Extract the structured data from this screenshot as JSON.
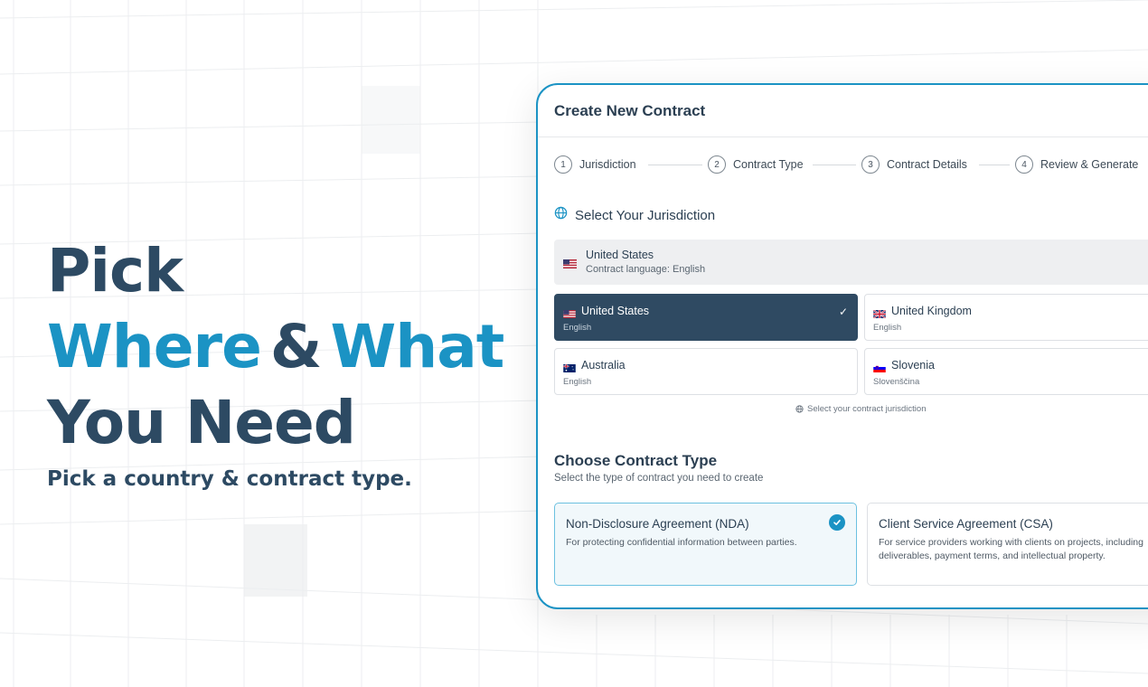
{
  "hero": {
    "line1": "Pick",
    "line2_word1": "Where",
    "line2_amp": "&",
    "line2_word2": "What",
    "line3": "You Need",
    "tagline": "Pick a country & contract type."
  },
  "dialog": {
    "title": "Create New Contract",
    "steps": [
      {
        "num": "1",
        "label": "Jurisdiction"
      },
      {
        "num": "2",
        "label": "Contract Type"
      },
      {
        "num": "3",
        "label": "Contract Details"
      },
      {
        "num": "4",
        "label": "Review & Generate"
      }
    ],
    "jurisdiction": {
      "heading": "Select Your Jurisdiction",
      "heading_icon": "globe-icon",
      "selected": {
        "name": "United States",
        "language": "Contract language: English"
      },
      "options": [
        {
          "name": "United States",
          "language": "English",
          "flag": "us-flag-icon",
          "active": true
        },
        {
          "name": "United Kingdom",
          "language": "English",
          "flag": "uk-flag-icon",
          "active": false
        },
        {
          "name": "Australia",
          "language": "English",
          "flag": "au-flag-icon",
          "active": false
        },
        {
          "name": "Slovenia",
          "language": "Slovenščina",
          "flag": "si-flag-icon",
          "active": false
        }
      ],
      "hint": "Select your contract jurisdiction"
    },
    "contract_type": {
      "heading": "Choose Contract Type",
      "subheading": "Select the type of contract you need to create",
      "options": [
        {
          "name": "Non-Disclosure Agreement (NDA)",
          "description": "For protecting confidential information between parties.",
          "selected": true
        },
        {
          "name": "Client Service Agreement (CSA)",
          "description": "For service providers working with clients on projects, including deliverables, payment terms, and intellectual property.",
          "selected": false
        }
      ]
    }
  },
  "colors": {
    "brand_dark": "#2d4a63",
    "brand_blue": "#1b93c4",
    "active_card": "#2f4a62"
  }
}
